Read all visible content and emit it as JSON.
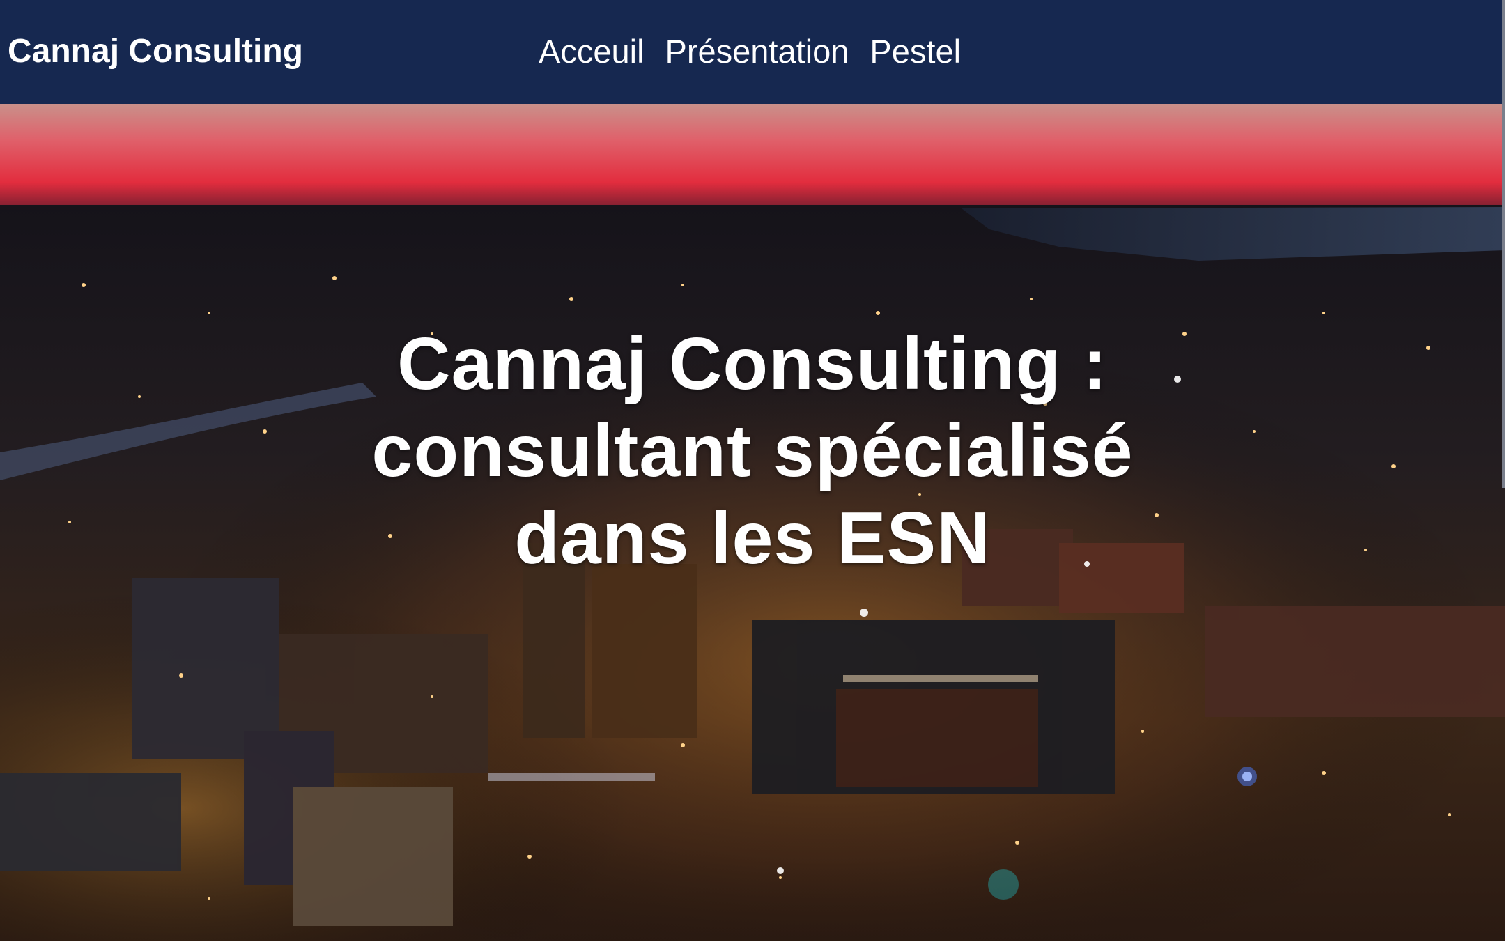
{
  "header": {
    "brand": "Cannaj Consulting",
    "nav": [
      {
        "label": "Acceuil"
      },
      {
        "label": "Présentation"
      },
      {
        "label": "Pestel"
      }
    ]
  },
  "hero": {
    "title_lines": [
      "Cannaj Consulting :",
      "consultant spécialisé",
      "dans les ESN"
    ],
    "background": "night-city-aerial-image"
  },
  "colors": {
    "navbar": "#162850",
    "text": "#ffffff",
    "sky_glow": "#e83a4a"
  }
}
